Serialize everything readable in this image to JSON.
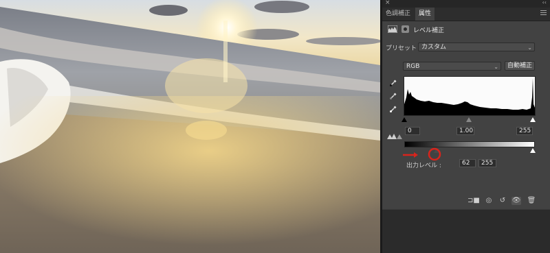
{
  "panel": {
    "close_glyph": "×",
    "collapse_glyph": "‹‹",
    "tabs": [
      {
        "label": "色調補正"
      },
      {
        "label": "属性"
      }
    ],
    "header": {
      "title": "レベル補正"
    },
    "preset": {
      "label": "プリセット :",
      "value": "カスタム"
    },
    "channel": {
      "value": "RGB"
    },
    "auto_button": "自動補正",
    "input_levels": {
      "shadow": "0",
      "midtone": "1.00",
      "highlight": "255"
    },
    "output": {
      "label": "出力レベル :",
      "low": "62",
      "high": "255"
    }
  },
  "colors": {
    "panel_bg": "#424242",
    "annotation_red": "#d8241c",
    "histogram_fill": "#fbfbfb"
  },
  "icons": [
    "close-icon",
    "collapse-icon",
    "panel-menu-icon",
    "levels-histogram-icon",
    "layer-mask-icon",
    "chevron-down-icon",
    "black-eyedropper-icon",
    "gray-eyedropper-icon",
    "white-eyedropper-icon",
    "input-levels-slider-icon",
    "clip-to-layer-icon",
    "view-previous-icon",
    "reset-icon",
    "visibility-icon",
    "trash-icon"
  ]
}
